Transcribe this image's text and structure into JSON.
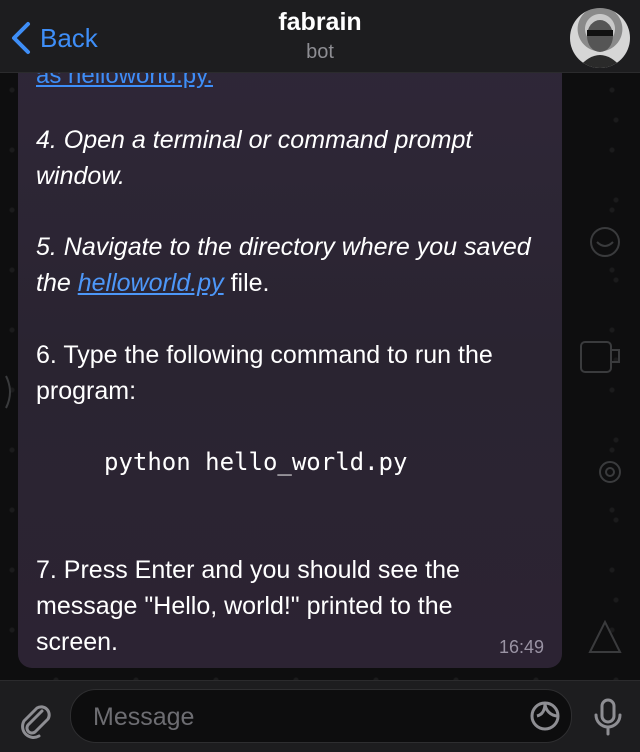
{
  "header": {
    "back_label": "Back",
    "title": "fabrain",
    "subtitle": "bot"
  },
  "message": {
    "cut_line": "as helloworld.py.",
    "step4": "4. Open a terminal or command prompt window.",
    "step5_before": "5. Navigate to the directory where you saved the ",
    "step5_link": "helloworld.py",
    "step5_after": " file.",
    "step6": "6. Type the following command to run the program:",
    "code": "python hello_world.py",
    "step7": "7. Press Enter and you should see the message \"Hello, world!\" printed to the screen.",
    "time": "16:49"
  },
  "input": {
    "placeholder": "Message",
    "value": ""
  },
  "icons": {
    "back": "chevron-left-icon",
    "attach": "paperclip-icon",
    "sticker": "sticker-icon",
    "mic": "microphone-icon"
  },
  "colors": {
    "accent": "#3e8ef7",
    "bubble": "#2c2534",
    "bar": "#1d1d1f"
  }
}
